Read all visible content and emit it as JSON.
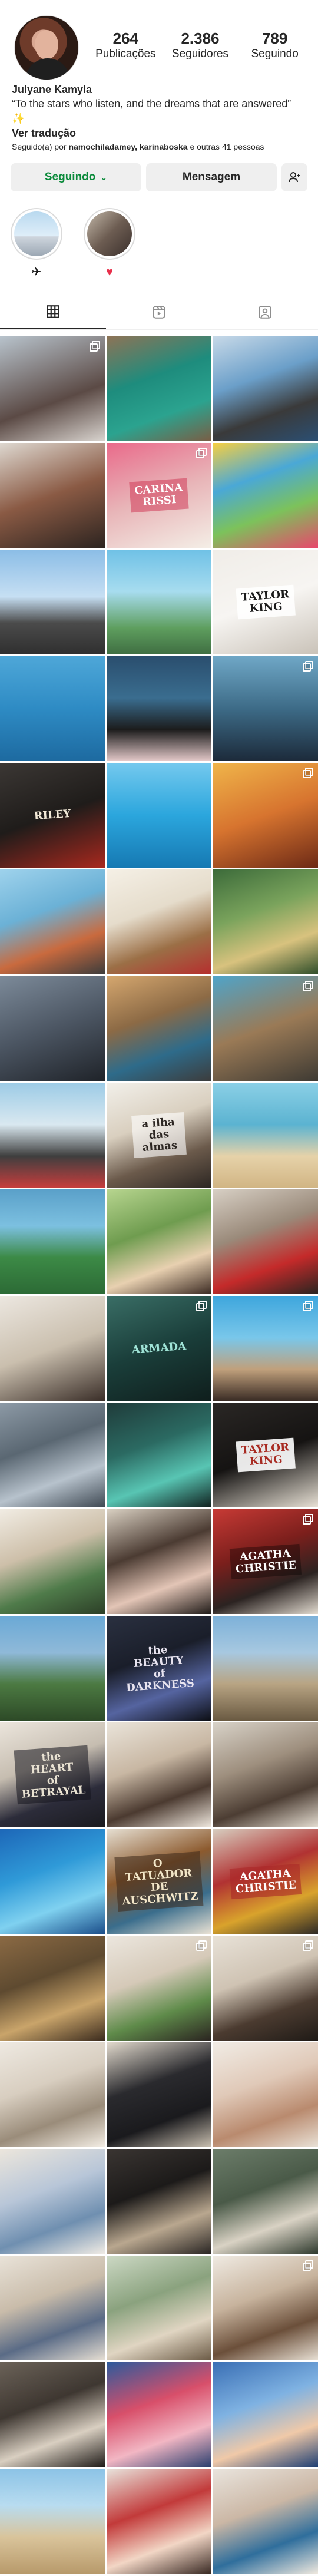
{
  "profile": {
    "display_name": "Julyane Kamyla",
    "bio_line1": "“To the stars who listen, and the dreams that are answered” ✨",
    "translate_label": "Ver tradução",
    "followed_by_prefix": "Seguido(a) por ",
    "followed_by_names": "namochiladamey, karinaboska",
    "followed_by_suffix": " e outras 41 pessoas"
  },
  "stats": [
    {
      "value": "264",
      "label": "Publicações"
    },
    {
      "value": "2.386",
      "label": "Seguidores"
    },
    {
      "value": "789",
      "label": "Seguindo"
    }
  ],
  "actions": {
    "following_label": "Seguindo",
    "message_label": "Mensagem",
    "add_icon": "add-person-icon"
  },
  "highlights": [
    {
      "icon": "airplane-icon",
      "glyph": "✈"
    },
    {
      "icon": "heart-icon",
      "glyph": "♥"
    }
  ],
  "tabs": [
    {
      "icon": "grid-icon",
      "active": true
    },
    {
      "icon": "reels-icon",
      "active": false
    },
    {
      "icon": "tagged-icon",
      "active": false
    }
  ],
  "colors": {
    "following_green": "#0a8a3a",
    "button_gray": "#efefef",
    "text": "#262626"
  },
  "posts": [
    {
      "bg": "linear-gradient(160deg,#b8c3cc,#5b4a45 60%,#d9d4cf)",
      "multi": true
    },
    {
      "bg": "linear-gradient(160deg,#8e7356,#1e8c7d 40%,#2ba38f 70%,#7a5d44)",
      "multi": false,
      "title": "",
      "title_color": "#fff",
      "title_bg": "transparent"
    },
    {
      "bg": "linear-gradient(160deg,#c7d9e8,#6b9fc9 40%,#3a3a3a 70%,#2b4f73)",
      "multi": false
    },
    {
      "bg": "linear-gradient(160deg,#ded8d0,#8a5a44 50%,#2d2420)",
      "multi": false
    },
    {
      "bg": "linear-gradient(160deg,#e96a8a,#e8b5b8 50%,#f4eee6)",
      "multi": true,
      "title": "CARINA RISSI",
      "title_color": "#fff",
      "title_bg": "rgba(208,60,90,0.55)"
    },
    {
      "bg": "linear-gradient(160deg,#f6cf42,#4aa8d6 35%,#7cc25b 65%,#e8476c)",
      "multi": false
    },
    {
      "bg": "linear-gradient(180deg,#8bbde6,#c6dff3 45%,#4b4b4b 70%,#2f2f2f)",
      "multi": false
    },
    {
      "bg": "linear-gradient(180deg,#6fc1e6,#a7dcef 40%,#5e9e5e 75%,#3f6e42)",
      "multi": false
    },
    {
      "bg": "linear-gradient(160deg,#f0ede8,#f7f5f2 50%,#c9c2b8)",
      "multi": false,
      "title": "TAYLOR\nKING",
      "title_color": "#1a1a1a",
      "title_bg": "rgba(255,255,255,0.85)"
    },
    {
      "bg": "linear-gradient(180deg,#4ea7d8,#2e8bc4 50%,#1d6aa0)",
      "multi": false
    },
    {
      "bg": "linear-gradient(180deg,#2a4e6e,#3a6d8f 40%,#1c1c1c 70%,#e4c9c9)",
      "multi": false
    },
    {
      "bg": "linear-gradient(180deg,#6fa7c6,#3d6b87 50%,#1c2a3a)",
      "multi": true
    },
    {
      "bg": "linear-gradient(160deg,#3b3734,#1f1c1a 50%,#a8281e)",
      "multi": false,
      "title": "RILEY",
      "title_color": "#f3ead8",
      "title_bg": "transparent"
    },
    {
      "bg": "linear-gradient(180deg,#74c9ee,#2ba6dd 50%,#1679b3)",
      "multi": false
    },
    {
      "bg": "linear-gradient(160deg,#f0b54a,#d7742f 50%,#6d2a16)",
      "multi": true,
      "title": "",
      "title_color": "#fff",
      "title_bg": "transparent"
    },
    {
      "bg": "linear-gradient(160deg,#9ed2ec,#6bb1d6 40%,#c96a3e 70%,#3c3c3c)",
      "multi": false
    },
    {
      "bg": "linear-gradient(160deg,#f5f0e6,#e5dccb 40%,#9b6f46 70%,#b62e2e)",
      "multi": false
    },
    {
      "bg": "linear-gradient(160deg,#3c6b3a,#7aa35c 40%,#d8c27e 70%,#2f4e2a)",
      "multi": false
    },
    {
      "bg": "linear-gradient(160deg,#7c8a99,#4c5663 50%,#1f2329)",
      "multi": false
    },
    {
      "bg": "linear-gradient(160deg,#d5a76f,#8c6a45 40%,#2e6b8a 70%,#3c3c3c)",
      "multi": false
    },
    {
      "bg": "linear-gradient(160deg,#4fa4c9,#9a7a56 50%,#3e3a33)",
      "multi": true
    },
    {
      "bg": "linear-gradient(180deg,#9ccbe6,#d9e8f0 40%,#3e3e3e 70%,#c63d3d)",
      "multi": false
    },
    {
      "bg": "linear-gradient(160deg,#f2f0ea,#d9cfbf 40%,#6b5a4b 70%,#2c2622)",
      "multi": false,
      "title": "a ilha\ndas almas",
      "title_color": "#2c2622",
      "title_bg": "rgba(255,255,255,0.6)"
    },
    {
      "bg": "linear-gradient(180deg,#8bd0e6,#5bb3d1 40%,#e6d2a9 70%,#d1b584)",
      "multi": false
    },
    {
      "bg": "linear-gradient(180deg,#5aa0c9,#7cc0e0 35%,#3c8a46 65%,#2c6a35)",
      "multi": false
    },
    {
      "bg": "linear-gradient(160deg,#b7d58f,#6f9c4f 40%,#e8d0b0 70%,#3b2a22)",
      "multi": false
    },
    {
      "bg": "linear-gradient(160deg,#d7cfc4,#9a8a7a 40%,#c42a2a 70%,#2a2420)",
      "multi": false
    },
    {
      "bg": "linear-gradient(160deg,#ece7e0,#cabfae 50%,#3a2e28)",
      "multi": false
    },
    {
      "bg": "linear-gradient(160deg,#3a6e66,#1a3e3a 50%,#0f1e1c)",
      "multi": true,
      "title": "ARMADA",
      "title_color": "#9fe3d6",
      "title_bg": "transparent"
    },
    {
      "bg": "linear-gradient(180deg,#3ea6dd,#79c7ea 40%,#c0a07c 70%,#3a2c25)",
      "multi": true
    },
    {
      "bg": "linear-gradient(160deg,#8d9aa6,#5a6772 40%,#b7c2cc 70%,#3e4852)",
      "multi": false
    },
    {
      "bg": "linear-gradient(160deg,#1f3b3a,#2b6a62 40%,#58c5b3 70%,#10201e)",
      "multi": false
    },
    {
      "bg": "linear-gradient(160deg,#2a2725,#151312 50%,#e9e2d6)",
      "multi": false,
      "title": "TAYLOR KING",
      "title_color": "#a82b22",
      "title_bg": "rgba(255,255,255,0.9)"
    },
    {
      "bg": "linear-gradient(160deg,#f1ece3,#cdbfa9 40%,#4f7b4a 70%,#2c3f27)",
      "multi": false
    },
    {
      "bg": "linear-gradient(160deg,#d9d0c2,#4b3b32 40%,#e3c5b6 70%,#1f1a17)",
      "multi": false
    },
    {
      "bg": "linear-gradient(160deg,#c73a35,#7c1f1c 40%,#2b2321 70%,#e2dbd0)",
      "multi": true,
      "title": "AGATHA\nCHRISTIE",
      "title_color": "#fff",
      "title_bg": "rgba(0,0,0,0.35)"
    },
    {
      "bg": "linear-gradient(180deg,#6aa9d6,#8fb9d8 35%,#4c7a42 65%,#2d4a27)",
      "multi": false
    },
    {
      "bg": "linear-gradient(160deg,#2a3040,#1a1e2a 40%,#5564a0 70%,#0c0e14)",
      "multi": false,
      "title": "the BEAUTY\nof DARKNESS",
      "title_color": "#e8e4f0",
      "title_bg": "transparent"
    },
    {
      "bg": "linear-gradient(180deg,#7db1d9,#a7c8e0 35%,#b8a483 65%,#6a5a42)",
      "multi": false
    },
    {
      "bg": "linear-gradient(160deg,#ebe5dc,#c6bdb0 40%,#2c2c3a 70%,#1a1a1f)",
      "multi": false,
      "title": "the HEART\nof BETRAYAL",
      "title_color": "#e9e2d2",
      "title_bg": "rgba(20,20,30,0.55)"
    },
    {
      "bg": "linear-gradient(160deg,#eae4da,#c8b7a3 40%,#4b3a30 70%,#f0e8de)",
      "multi": false
    },
    {
      "bg": "linear-gradient(160deg,#d8d2c8,#9e8f7e 40%,#4c3d33 70%,#e5ddd1)",
      "multi": false
    },
    {
      "bg": "linear-gradient(160deg,#1d67b8,#2f9ad8 40%,#7fd1f0 70%,#1b4e8a)",
      "multi": false
    },
    {
      "bg": "linear-gradient(160deg,#e6dfd2,#8c5a2e 40%,#3a6d8c 70%,#eae2d4)",
      "multi": false,
      "title": "O TATUADOR\nDE AUSCHWITZ",
      "title_color": "#f2e6c8",
      "title_bg": "rgba(60,40,25,0.55)"
    },
    {
      "bg": "linear-gradient(160deg,#d7cdbf,#b13232 40%,#d9a32c 70%,#2e2a26)",
      "multi": false,
      "title": "AGATHA\nCHRISTIE",
      "title_color": "#fff",
      "title_bg": "rgba(170,40,40,0.6)"
    },
    {
      "bg": "linear-gradient(160deg,#8b6a44,#5e4a30 40%,#c9a46a 70%,#3c2c1e)",
      "multi": false
    },
    {
      "bg": "linear-gradient(160deg,#ece7df,#d5c9b8 40%,#5f8b4a 70%,#2a2420)",
      "multi": true
    },
    {
      "bg": "linear-gradient(160deg,#e8e2d8,#cfc3b3 40%,#4b3b30 70%,#1f1a16)",
      "multi": true
    },
    {
      "bg": "linear-gradient(160deg,#eee9e1,#d8cec0 40%,#9a8c7a 70%,#f3ede4)",
      "multi": false
    },
    {
      "bg": "linear-gradient(160deg,#e2dacd,#2a2a2e 40%,#1a1a1d 70%,#c9bfb0)",
      "multi": false
    },
    {
      "bg": "linear-gradient(160deg,#f1ece5,#e0c9b8 40%,#b98a6e 70%,#e9e1d6)",
      "multi": false
    },
    {
      "bg": "linear-gradient(160deg,#ece6dc,#b8c6d8 40%,#6f8fb0 70%,#f0ebe4)",
      "multi": false
    },
    {
      "bg": "linear-gradient(160deg,#3a3532,#1c1a19 40%,#b9a78f 70%,#2a2624)",
      "multi": false
    },
    {
      "bg": "linear-gradient(160deg,#6c7d6a,#4a5a48 40%,#d9d2c4 70%,#2f3a2e)",
      "multi": false
    },
    {
      "bg": "linear-gradient(160deg,#e9e3d9,#c9bcaa 40%,#5a6b86 70%,#e7dfd3)",
      "multi": false
    },
    {
      "bg": "linear-gradient(160deg,#cdd9c5,#8aa27e 40%,#e0d5c2 70%,#6b5a45)",
      "multi": false
    },
    {
      "bg": "linear-gradient(160deg,#f0ebe3,#c7b39d 40%,#6b4f3a 70%,#e8e0d4)",
      "multi": true
    },
    {
      "bg": "linear-gradient(160deg,#6b6258,#3e3731 40%,#d9cfc1 70%,#1f1b18)",
      "multi": false
    },
    {
      "bg": "linear-gradient(160deg,#2c5a9c,#d84f6a 40%,#f2b6c3 70%,#2a3e6e)",
      "multi": false
    },
    {
      "bg": "linear-gradient(160deg,#3a6fb5,#7fb2e2 40%,#f0c9a8 70%,#1f3f73)",
      "multi": false
    },
    {
      "bg": "linear-gradient(180deg,#8cc3e6,#b8dcf0 35%,#d9c49b 65%,#b89a6b)",
      "multi": false
    },
    {
      "bg": "linear-gradient(160deg,#e8e3dc,#c23a3a 40%,#f2d6c5 70%,#3a2a24)",
      "multi": false
    },
    {
      "bg": "linear-gradient(160deg,#e9e4dd,#cbb7a5 40%,#2f6e9c 70%,#efe8de)",
      "multi": false
    }
  ]
}
